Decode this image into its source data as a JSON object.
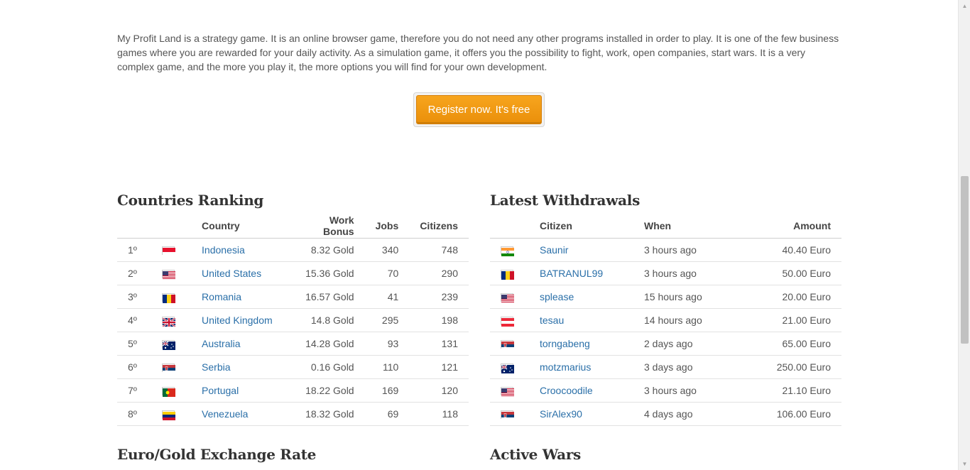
{
  "intro": {
    "text": "My Profit Land is a strategy game. It is an online browser game, therefore you do not need any other programs installed in order to play. It is one of the few business games where you are rewarded for your daily activity. As a simulation game, it offers you the possibility to fight, work, open companies, start wars. It is a very complex game, and the more you play it, the more options you will find for your own development."
  },
  "cta": {
    "label": "Register now. It's free"
  },
  "ranking": {
    "title": "Countries Ranking",
    "headers": {
      "country": "Country",
      "bonus": "Work Bonus",
      "jobs": "Jobs",
      "citizens": "Citizens"
    },
    "rows": [
      {
        "rank": "1º",
        "flag": "indonesia-flag",
        "country": "Indonesia",
        "bonus": "8.32 Gold",
        "jobs": "340",
        "citizens": "748"
      },
      {
        "rank": "2º",
        "flag": "united-states-flag",
        "country": "United States",
        "bonus": "15.36 Gold",
        "jobs": "70",
        "citizens": "290"
      },
      {
        "rank": "3º",
        "flag": "romania-flag",
        "country": "Romania",
        "bonus": "16.57 Gold",
        "jobs": "41",
        "citizens": "239"
      },
      {
        "rank": "4º",
        "flag": "united-kingdom-flag",
        "country": "United Kingdom",
        "bonus": "14.8 Gold",
        "jobs": "295",
        "citizens": "198"
      },
      {
        "rank": "5º",
        "flag": "australia-flag",
        "country": "Australia",
        "bonus": "14.28 Gold",
        "jobs": "93",
        "citizens": "131"
      },
      {
        "rank": "6º",
        "flag": "serbia-flag",
        "country": "Serbia",
        "bonus": "0.16 Gold",
        "jobs": "110",
        "citizens": "121"
      },
      {
        "rank": "7º",
        "flag": "portugal-flag",
        "country": "Portugal",
        "bonus": "18.22 Gold",
        "jobs": "169",
        "citizens": "120"
      },
      {
        "rank": "8º",
        "flag": "venezuela-flag",
        "country": "Venezuela",
        "bonus": "18.32 Gold",
        "jobs": "69",
        "citizens": "118"
      }
    ]
  },
  "withdrawals": {
    "title": "Latest Withdrawals",
    "headers": {
      "citizen": "Citizen",
      "when": "When",
      "amount": "Amount"
    },
    "rows": [
      {
        "flag": "india-flag",
        "citizen": "Saunir",
        "when": "3 hours ago",
        "amount": "40.40 Euro"
      },
      {
        "flag": "romania-flag",
        "citizen": "BATRANUL99",
        "when": "3 hours ago",
        "amount": "50.00 Euro"
      },
      {
        "flag": "united-states-flag",
        "citizen": "splease",
        "when": "15 hours ago",
        "amount": "20.00 Euro"
      },
      {
        "flag": "austria-flag",
        "citizen": "tesau",
        "when": "14 hours ago",
        "amount": "21.00 Euro"
      },
      {
        "flag": "serbia-flag",
        "citizen": "torngabeng",
        "when": "2 days ago",
        "amount": "65.00 Euro"
      },
      {
        "flag": "australia-flag",
        "citizen": "motzmarius",
        "when": "3 days ago",
        "amount": "250.00 Euro"
      },
      {
        "flag": "united-states-flag",
        "citizen": "Croocoodile",
        "when": "3 hours ago",
        "amount": "21.10 Euro"
      },
      {
        "flag": "serbia-flag",
        "citizen": "SirAlex90",
        "when": "4 days ago",
        "amount": "106.00 Euro"
      }
    ]
  },
  "exchange": {
    "title": "Euro/Gold Exchange Rate"
  },
  "wars": {
    "title": "Active Wars"
  },
  "colors": {
    "accent": "#f39c12",
    "link": "#2a6fa8"
  }
}
